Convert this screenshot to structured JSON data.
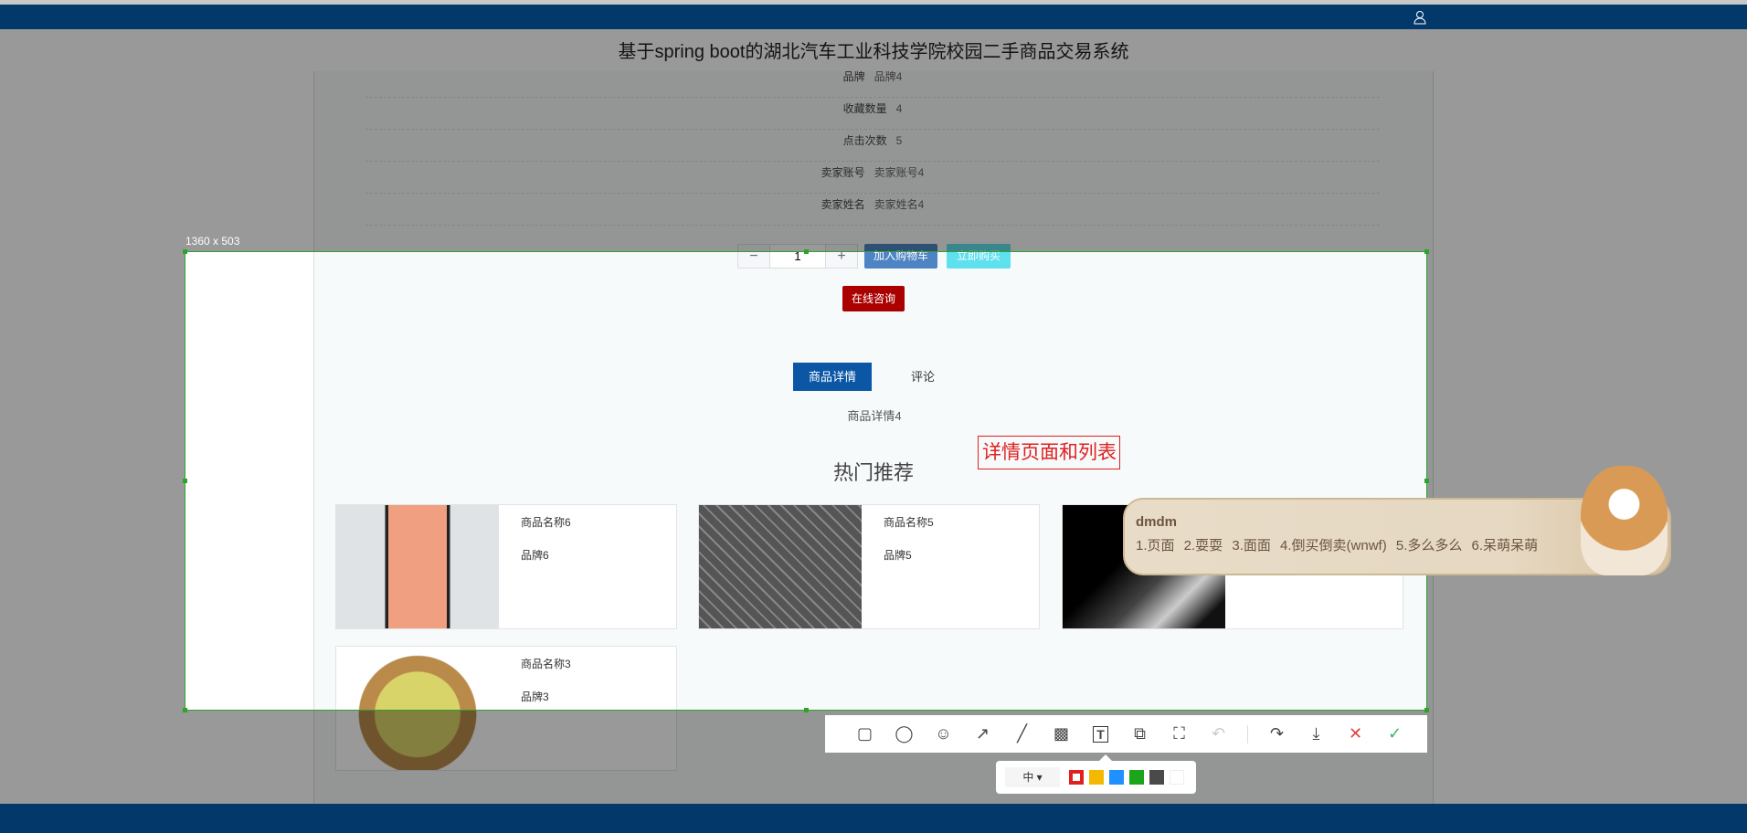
{
  "header": {
    "title": "基于spring boot的湖北汽车工业科技学院校园二手商品交易系统",
    "user_icon": "user-icon"
  },
  "info_rows": [
    {
      "label": "品牌",
      "value": "品牌4"
    },
    {
      "label": "收藏数量",
      "value": "4"
    },
    {
      "label": "点击次数",
      "value": "5"
    },
    {
      "label": "卖家账号",
      "value": "卖家账号4"
    },
    {
      "label": "卖家姓名",
      "value": "卖家姓名4"
    }
  ],
  "purchase": {
    "minus": "−",
    "quantity": "1",
    "plus": "+",
    "add_cart": "加入购物车",
    "buy_now": "立即购买",
    "consult": "在线咨询"
  },
  "tabs": [
    {
      "label": "商品详情",
      "active": true
    },
    {
      "label": "评论",
      "active": false
    }
  ],
  "detail_text": "商品详情4",
  "hot": {
    "title": "热门推荐",
    "items": [
      {
        "name": "商品名称6",
        "brand": "品牌6"
      },
      {
        "name": "商品名称5",
        "brand": "品牌5"
      },
      {
        "name": "",
        "brand": ""
      },
      {
        "name": "商品名称3",
        "brand": "品牌3"
      }
    ]
  },
  "screenshot_tool": {
    "size_label": "1360 x 503",
    "annotation": "详情页面和列表",
    "font_size": "中 ▾",
    "colors": [
      "#e02020",
      "#f5b800",
      "#1e90ff",
      "#1aa51a",
      "#4a4a4a",
      "#ffffff"
    ],
    "tools": [
      "rectangle",
      "ellipse",
      "emoji",
      "arrow",
      "pen",
      "mosaic",
      "text",
      "pin",
      "ocr",
      "undo",
      "share",
      "save",
      "cancel",
      "confirm"
    ]
  },
  "ime": {
    "composition": "dmdm",
    "candidates": "1.页面 2.耍耍 3.面面 4.倒买倒卖(wnwf) 5.多么多么 6.呆萌呆萌"
  }
}
